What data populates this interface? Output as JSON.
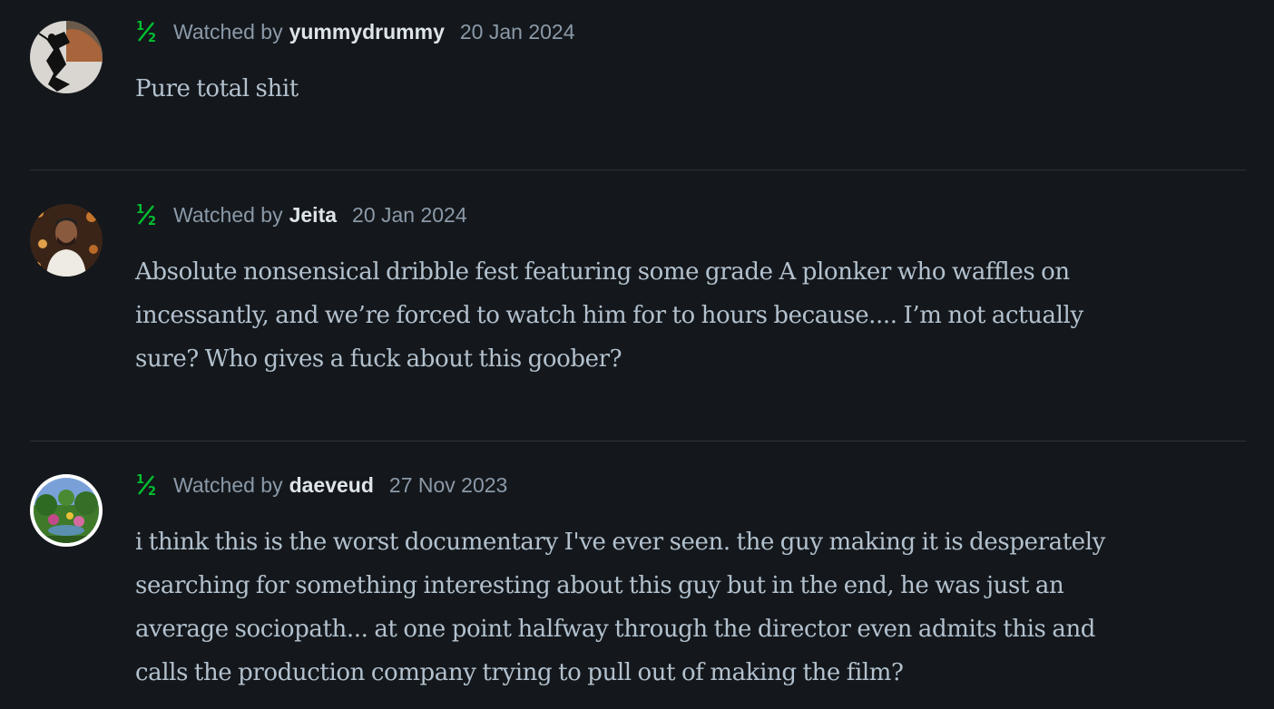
{
  "reviews": [
    {
      "rating": "½",
      "rating_color": "#00c030",
      "watched_by": "Watched by",
      "username": "yummydrummy",
      "date": "20 Jan 2024",
      "lines": [
        "Pure total shit"
      ]
    },
    {
      "rating": "½",
      "rating_color": "#00c030",
      "watched_by": "Watched by",
      "username": "Jeita",
      "date": "20 Jan 2024",
      "lines": [
        "Absolute nonsensical dribble fest featuring some grade A plonker who waffles on",
        "incessantly, and we’re forced to watch him for to hours because.... I’m not actually",
        "sure? Who gives a fuck about this goober?"
      ]
    },
    {
      "rating": "½",
      "rating_color": "#00c030",
      "watched_by": "Watched by",
      "username": "daeveud",
      "date": "27 Nov 2023",
      "lines": [
        "i think this is the worst documentary I've ever seen. the guy making it is desperately",
        "searching for something interesting about this guy but in the end, he was just an",
        "average sociopath... at one point halfway through the director even admits this and",
        "calls the production company trying to pull out of making the film?"
      ]
    }
  ]
}
